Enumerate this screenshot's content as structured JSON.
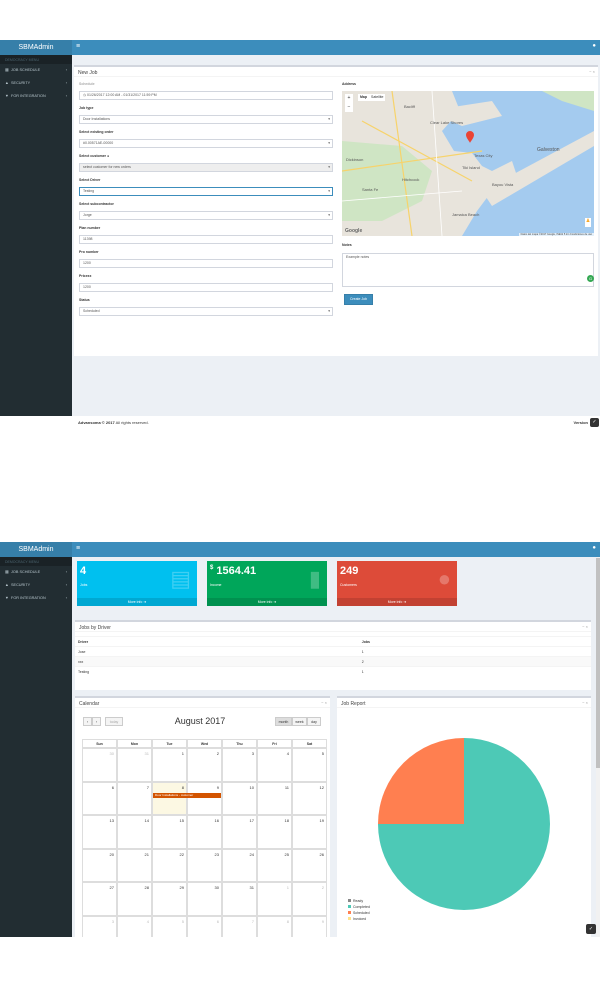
{
  "app": {
    "brand": "SBMAdmin",
    "version_label": "Version"
  },
  "sidebar": {
    "header": "DEMOCRACY MENU",
    "items": [
      {
        "label": "JOB SCHEDULE",
        "icon": "calendar-icon"
      },
      {
        "label": "SECURITY",
        "icon": "user-icon"
      },
      {
        "label": "FOR INTEGRATION",
        "icon": "filter-icon"
      }
    ]
  },
  "form": {
    "title": "New Job",
    "schedule_label": "Schedule",
    "schedule_value": "01/26/2017 12:00 AM - 01/31/2017 11:59 PM",
    "job_type_label": "Job type",
    "job_type_value": "Door Installations",
    "existing_order_label": "Select existing order",
    "existing_order_value": "#0.00571AE-00000",
    "customer_label": "Select customer",
    "customer_value": "select customer for new orders",
    "driver_label": "Select Driver",
    "driver_value": "Testing",
    "subcontractor_label": "Select subcontractor",
    "subcontractor_value": "Jorge",
    "plan_label": "Plan number",
    "plan_value": "11398",
    "pro_label": "Pro number",
    "pro_value": "1200",
    "price_label": "Pricexx",
    "price_value": "1200",
    "status_label": "Status",
    "status_value": "Scheduled",
    "address_label": "Address",
    "notes_label": "Notes",
    "notes_value": "Example notes",
    "create_button": "Create Job",
    "map_type_map": "Map",
    "map_type_sat": "Satellite",
    "map_zoom_in": "+",
    "map_zoom_out": "−",
    "map_google": "Google",
    "map_attrib": "Datos del mapa ©2017 Google, INEGI   5 km   Condiciones de uso",
    "places": [
      "Texas City",
      "Clear Lake Shores",
      "Dickinson",
      "Bayou Vista",
      "Tiki Island",
      "Galveston",
      "Santa Fe",
      "Hitchcock",
      "Bacliff",
      "Jamaica Beach"
    ]
  },
  "footer": {
    "copyright_strong": "Advansoma © 2017",
    "copyright_rest": " All rights reserved."
  },
  "dashboard": {
    "stats": [
      {
        "value": "4",
        "label": "Jobs",
        "link": "More info",
        "color": "#00c0ef",
        "icon": "building-icon"
      },
      {
        "value": "1564.41",
        "prefix": "$",
        "label": "Income",
        "link": "More info",
        "color": "#00a65a",
        "icon": "bar-chart-icon"
      },
      {
        "value": "249",
        "label": "Customers",
        "link": "More info",
        "color": "#dd4b39",
        "icon": "users-icon"
      }
    ],
    "jobs_by_driver": {
      "title": "Jobs by Driver",
      "headers": [
        "Driver",
        "Jobs"
      ],
      "rows": [
        [
          "Jose",
          "1"
        ],
        [
          "xxx",
          "2"
        ],
        [
          "Testing",
          "1"
        ]
      ]
    },
    "calendar": {
      "title": "Calendar",
      "month": "August 2017",
      "today": "today",
      "views": [
        "month",
        "week",
        "day"
      ],
      "weekdays": [
        "Sun",
        "Mon",
        "Tue",
        "Wed",
        "Thu",
        "Fri",
        "Sat"
      ],
      "weeks": [
        [
          "30",
          "31",
          "1",
          "2",
          "3",
          "4",
          "5"
        ],
        [
          "6",
          "7",
          "8",
          "9",
          "10",
          "11",
          "12"
        ],
        [
          "13",
          "14",
          "15",
          "16",
          "17",
          "18",
          "19"
        ],
        [
          "20",
          "21",
          "22",
          "23",
          "24",
          "25",
          "26"
        ],
        [
          "27",
          "28",
          "29",
          "30",
          "31",
          "1",
          "2"
        ],
        [
          "3",
          "4",
          "5",
          "6",
          "7",
          "8",
          "9"
        ]
      ],
      "event": "Door Installations - customer"
    },
    "job_report": {
      "title": "Job Report"
    }
  },
  "chart_data": {
    "type": "pie",
    "title": "Job Report",
    "labels": [
      "Ready",
      "Completed",
      "Scheduled",
      "Invoiced"
    ],
    "colors": [
      "#888888",
      "#4dc9b6",
      "#ff7f50",
      "#ffe38a"
    ],
    "values": [
      0,
      3,
      1,
      0
    ],
    "legend_position": "bottom-left"
  }
}
